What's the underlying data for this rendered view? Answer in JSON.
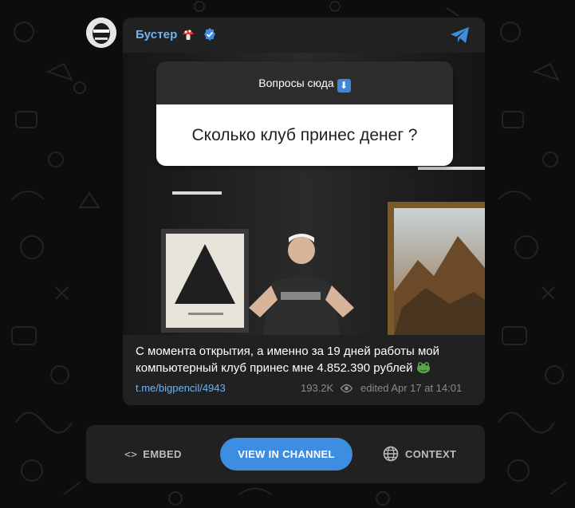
{
  "post": {
    "channel_name": "Бустер",
    "channel_emoji_icon": "mushroom-icon",
    "verified_icon": "verified-badge-icon",
    "share_icon": "telegram-plane-icon",
    "question_header": "Вопросы сюда",
    "question_header_emoji": "⬇",
    "question_text": "Сколько клуб принес денег ?",
    "caption_line1": "С момента открытия, а именно за 19 дней работы мой",
    "caption_line2": "компьютерный клуб принес мне 4.852.390 рублей",
    "caption_emoji_icon": "frog-emoji-icon",
    "link": "t.me/bigpencil/4943",
    "views": "193.2K",
    "edited": "edited  Apr 17 at 14:01"
  },
  "actions": {
    "embed_icon": "<>",
    "embed_label": "EMBED",
    "view_label": "VIEW IN CHANNEL",
    "context_label": "CONTEXT"
  },
  "colors": {
    "accent": "#6fb3f0",
    "button": "#3d8ee0",
    "card": "#212121",
    "background": "#0d0d0d"
  }
}
